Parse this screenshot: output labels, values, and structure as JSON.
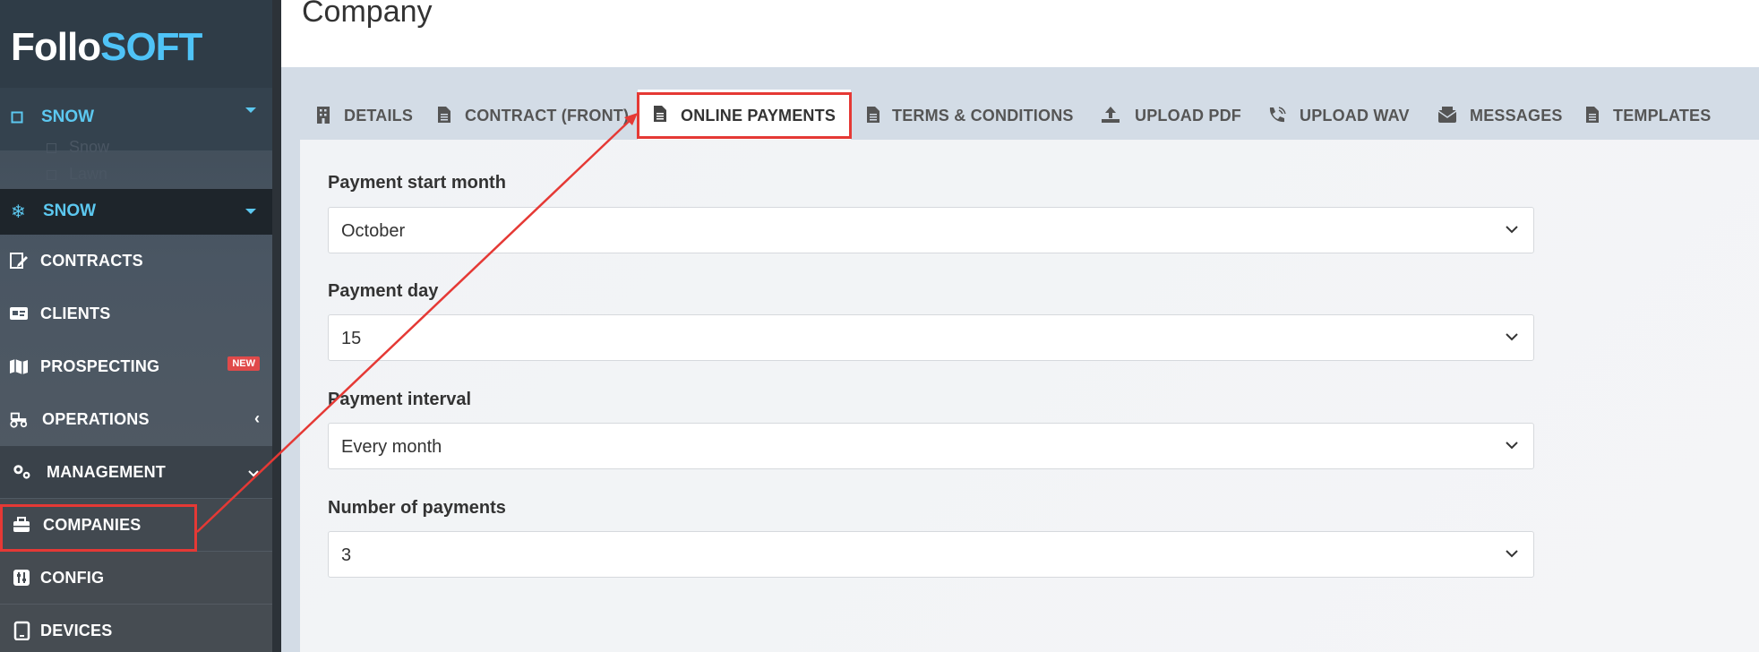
{
  "page": {
    "title": "Company"
  },
  "sidebar": {
    "logo": {
      "part1": "Follo",
      "part2": "SOFT"
    },
    "season_primary": {
      "label": "SNOW"
    },
    "season_options": [
      "Snow",
      "Lawn"
    ],
    "season_secondary": {
      "label": "SNOW"
    },
    "items": [
      {
        "label": "CONTRACTS"
      },
      {
        "label": "CLIENTS"
      },
      {
        "label": "PROSPECTING",
        "badge": "NEW"
      },
      {
        "label": "OPERATIONS"
      },
      {
        "label": "MANAGEMENT"
      },
      {
        "label": "COMPANIES"
      },
      {
        "label": "CONFIG"
      },
      {
        "label": "DEVICES"
      }
    ]
  },
  "tabs": [
    {
      "label": "DETAILS",
      "icon": "building-icon"
    },
    {
      "label": "CONTRACT (FRONT)",
      "icon": "document-icon"
    },
    {
      "label": "ONLINE PAYMENTS",
      "icon": "document-icon",
      "active": true
    },
    {
      "label": "TERMS & CONDITIONS",
      "icon": "document-icon"
    },
    {
      "label": "UPLOAD PDF",
      "icon": "upload-icon"
    },
    {
      "label": "UPLOAD WAV",
      "icon": "phone-icon"
    },
    {
      "label": "MESSAGES",
      "icon": "envelope-icon"
    },
    {
      "label": "TEMPLATES",
      "icon": "document-icon"
    }
  ],
  "form": {
    "fields": [
      {
        "label": "Payment start month",
        "value": "October"
      },
      {
        "label": "Payment day",
        "value": "15"
      },
      {
        "label": "Payment interval",
        "value": "Every month"
      },
      {
        "label": "Number of payments",
        "value": "3"
      }
    ]
  },
  "colors": {
    "accent": "#4fc3f7",
    "highlight": "#e53935",
    "badge": "#e04a4a"
  }
}
